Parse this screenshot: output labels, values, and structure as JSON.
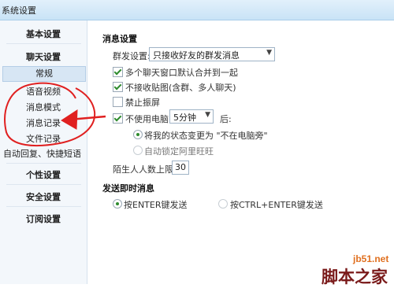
{
  "window": {
    "title": "系统设置"
  },
  "sidebar": {
    "groups": [
      {
        "label": "基本设置"
      },
      {
        "label": "聊天设置",
        "items": [
          "常规",
          "语音视频",
          "消息模式",
          "消息记录",
          "文件记录",
          "自动回复、快捷短语"
        ],
        "selected": "常规"
      },
      {
        "label": "个性设置"
      },
      {
        "label": "安全设置"
      },
      {
        "label": "订阅设置"
      }
    ]
  },
  "message_settings": {
    "heading": "消息设置",
    "group_send_label": "群发设置:",
    "group_send_value": "只接收好友的群发消息",
    "merge_windows": {
      "label": "多个聊天窗口默认合并到一起",
      "checked": true
    },
    "no_stickers": {
      "label": "不接收贴图(含群、多人聊天)",
      "checked": true
    },
    "no_shake": {
      "label": "禁止振屏",
      "checked": false
    },
    "idle": {
      "label": "不使用电脑",
      "checked": true,
      "value": "5分钟",
      "suffix": "后:"
    },
    "idle_options": [
      {
        "label": "将我的状态变更为 \"不在电脑旁\"",
        "selected": true
      },
      {
        "label": "自动锁定阿里旺旺",
        "selected": false
      }
    ],
    "stranger_limit_label": "陌生人人数上限:",
    "stranger_limit_value": "30"
  },
  "send_settings": {
    "heading": "发送即时消息",
    "options": [
      {
        "label": "按ENTER键发送",
        "selected": true
      },
      {
        "label": "按CTRL+ENTER键发送",
        "selected": false
      }
    ]
  },
  "watermark": {
    "site": "jb51.net",
    "name": "脚本之家"
  },
  "colors": {
    "check": "#2e8b2e",
    "annotation": "#e02020",
    "watermark_top": "#e07020",
    "watermark_bottom": "#7a1a1a"
  }
}
